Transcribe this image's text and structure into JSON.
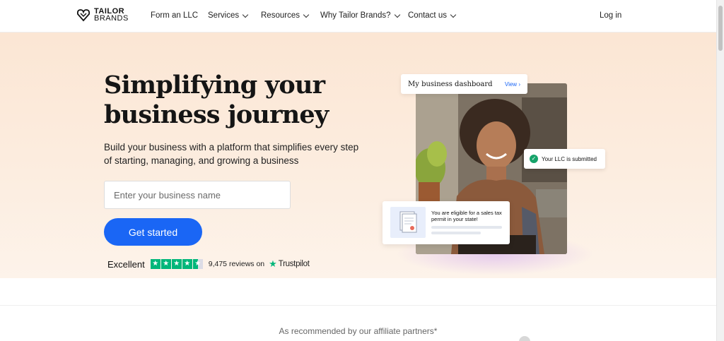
{
  "header": {
    "logo_line1": "TAILOR",
    "logo_line2": "BRANDS",
    "nav": [
      {
        "label": "Form an LLC",
        "has_dropdown": false
      },
      {
        "label": "Services",
        "has_dropdown": true
      },
      {
        "label": "Resources",
        "has_dropdown": true
      },
      {
        "label": "Why Tailor Brands?",
        "has_dropdown": true
      },
      {
        "label": "Contact us",
        "has_dropdown": true
      }
    ],
    "login_label": "Log in"
  },
  "hero": {
    "headline_line1": "Simplifying your",
    "headline_line2": "business journey",
    "subheading": "Build your business with a platform that simplifies every step of starting, managing, and growing a business",
    "input_placeholder": "Enter your business name",
    "cta_label": "Get started"
  },
  "rating": {
    "label": "Excellent",
    "stars": 4.5,
    "reviews_text": "9,475 reviews on",
    "provider": "Trustpilot"
  },
  "visual": {
    "dashboard_title": "My business dashboard",
    "dashboard_link": "View",
    "llc_status": "Your LLC is submitted",
    "permit_message": "You are eligible for a sales tax permit in your state!"
  },
  "partners": {
    "text": "As recommended by our affiliate partners*"
  },
  "colors": {
    "accent": "#1a66f5",
    "trustpilot_green": "#00b67a",
    "success_green": "#16a36a",
    "hero_bg": "#fbe6d4"
  },
  "icons": {
    "logo": "heart-shield-logo-icon",
    "dropdown": "chevron-down-icon",
    "check": "check-circle-icon",
    "trustpilot": "star-icon",
    "link_arrow": "chevron-right-icon"
  }
}
